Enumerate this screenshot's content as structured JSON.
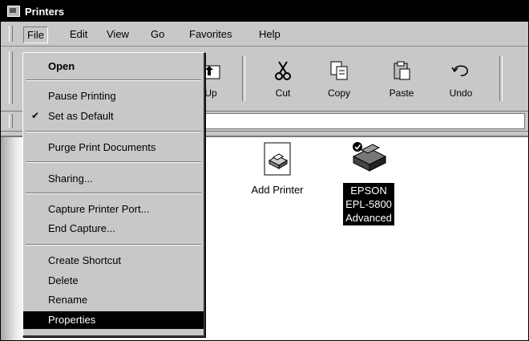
{
  "window": {
    "title": "Printers"
  },
  "menubar": {
    "items": [
      "File",
      "Edit",
      "View",
      "Go",
      "Favorites",
      "Help"
    ]
  },
  "toolbar": {
    "buttons": [
      {
        "label": "Up",
        "icon": "up-folder-icon"
      },
      {
        "label": "Cut",
        "icon": "scissors-icon"
      },
      {
        "label": "Copy",
        "icon": "copy-icon"
      },
      {
        "label": "Paste",
        "icon": "paste-icon"
      },
      {
        "label": "Undo",
        "icon": "undo-icon"
      }
    ]
  },
  "file_menu": {
    "items": [
      {
        "label": "Open",
        "bold": true
      },
      {
        "label": "Pause Printing"
      },
      {
        "label": "Set as Default",
        "checked": true
      },
      {
        "label": "Purge Print Documents"
      },
      {
        "label": "Sharing..."
      },
      {
        "label": "Capture Printer Port..."
      },
      {
        "label": "End Capture..."
      },
      {
        "label": "Create Shortcut"
      },
      {
        "label": "Delete"
      },
      {
        "label": "Rename"
      },
      {
        "label": "Properties",
        "highlighted": true
      }
    ]
  },
  "printers": [
    {
      "name": "Add Printer",
      "icon": "add-printer-icon"
    },
    {
      "name_lines": [
        "EPSON",
        "EPL-5800",
        "Advanced"
      ],
      "icon": "printer-icon",
      "selected": true,
      "default": true
    }
  ]
}
